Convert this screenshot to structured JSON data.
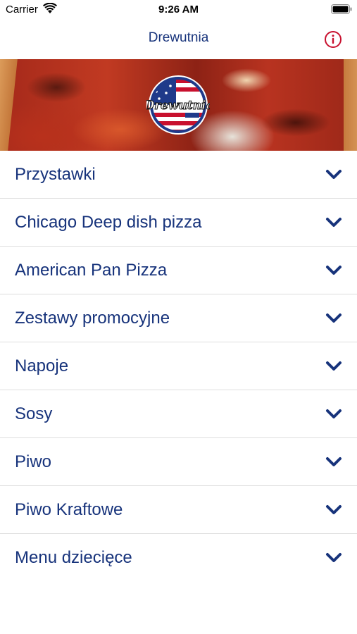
{
  "status_bar": {
    "carrier": "Carrier",
    "time": "9:26 AM"
  },
  "nav": {
    "title": "Drewutnia",
    "info_icon": "info-circle-icon"
  },
  "banner": {
    "logo_text": "Drewutnia"
  },
  "menu": {
    "chevron_icon": "chevron-down-icon",
    "items": [
      {
        "label": "Przystawki"
      },
      {
        "label": "Chicago Deep dish pizza"
      },
      {
        "label": "American Pan Pizza"
      },
      {
        "label": "Zestawy promocyjne"
      },
      {
        "label": "Napoje"
      },
      {
        "label": "Sosy"
      },
      {
        "label": "Piwo"
      },
      {
        "label": "Piwo Kraftowe"
      },
      {
        "label": "Menu dziecięce"
      }
    ]
  },
  "colors": {
    "primary": "#17337b",
    "info_icon": "#c8102e",
    "divider": "#dedede"
  }
}
